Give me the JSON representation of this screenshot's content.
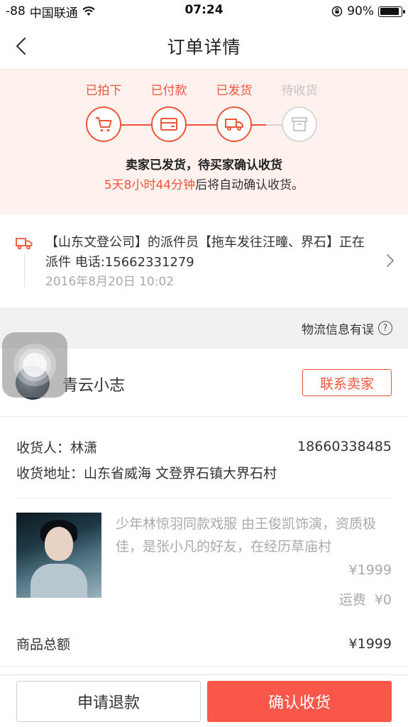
{
  "status_bar": {
    "signal": "-88",
    "carrier": "中国联通",
    "time": "07:24",
    "battery": "90%",
    "battery_level": 0.9
  },
  "nav": {
    "title": "订单详情",
    "back_icon": "chevron-left-icon"
  },
  "progress": {
    "accent_color": "#f0543a",
    "steps": [
      {
        "label": "已拍下",
        "icon": "cart-icon",
        "state": "done"
      },
      {
        "label": "已付款",
        "icon": "card-icon",
        "state": "done"
      },
      {
        "label": "已发货",
        "icon": "truck-icon",
        "state": "done"
      },
      {
        "label": "待收货",
        "icon": "box-icon",
        "state": "pending"
      }
    ],
    "status_text": "卖家已发货，待买家确认收货",
    "countdown": "5天8小时44分钟",
    "countdown_suffix": "后将自动确认收货。"
  },
  "logistics": {
    "icon": "truck-icon",
    "text": "【山东文登公司】的派件员【拖车发往汪疃、界石】正在派件 电话:15662331279",
    "time": "2016年8月20日 10:02",
    "error_link": "物流信息有误",
    "error_icon": "question-icon"
  },
  "seller": {
    "name": "青云小志",
    "contact_label": "联系卖家"
  },
  "address": {
    "receiver_label": "收货人：",
    "receiver_name": "林潇",
    "phone": "18660338485",
    "address_label": "收货地址：",
    "address": "山东省威海 文登界石镇大界石村"
  },
  "product": {
    "title": "少年林惊羽同款戏服 由王俊凯饰演，资质极佳，是张小凡的好友，在经历草庙村",
    "price": "¥1999",
    "shipping_label": "运费",
    "shipping_value": "¥0"
  },
  "total": {
    "label": "商品总额",
    "value": "¥1999"
  },
  "actions": {
    "refund_label": "申请退款",
    "confirm_label": "确认收货"
  }
}
